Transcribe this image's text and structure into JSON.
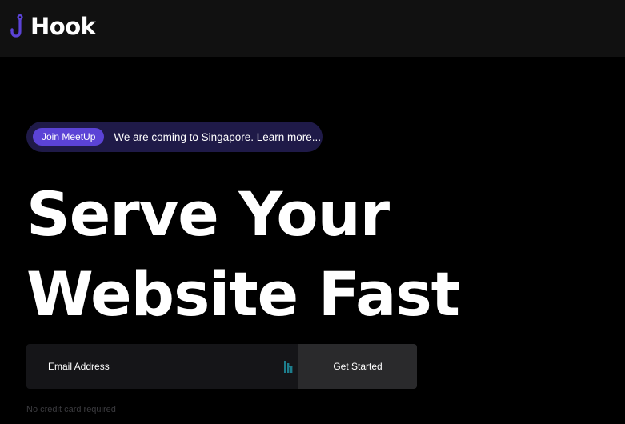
{
  "header": {
    "brand_name": "Hook",
    "brand_icon": "fish-hook-icon",
    "brand_color": "#5b43d6"
  },
  "announcement": {
    "badge_label": "Join MeetUp",
    "message": "We are coming to Singapore. Learn more..."
  },
  "hero": {
    "headline_line1": "Serve Your",
    "headline_line2": "Website Fast"
  },
  "signup": {
    "email_placeholder": "Email Address",
    "email_value": "",
    "autofill_icon": "password-manager-icon",
    "cta_label": "Get Started",
    "fine_print": "No credit card required"
  },
  "colors": {
    "background": "#000000",
    "navbar": "#111111",
    "accent": "#5b43d6",
    "announcement_bg": "#1f1a48",
    "cta_bg": "#2a2a2c"
  }
}
